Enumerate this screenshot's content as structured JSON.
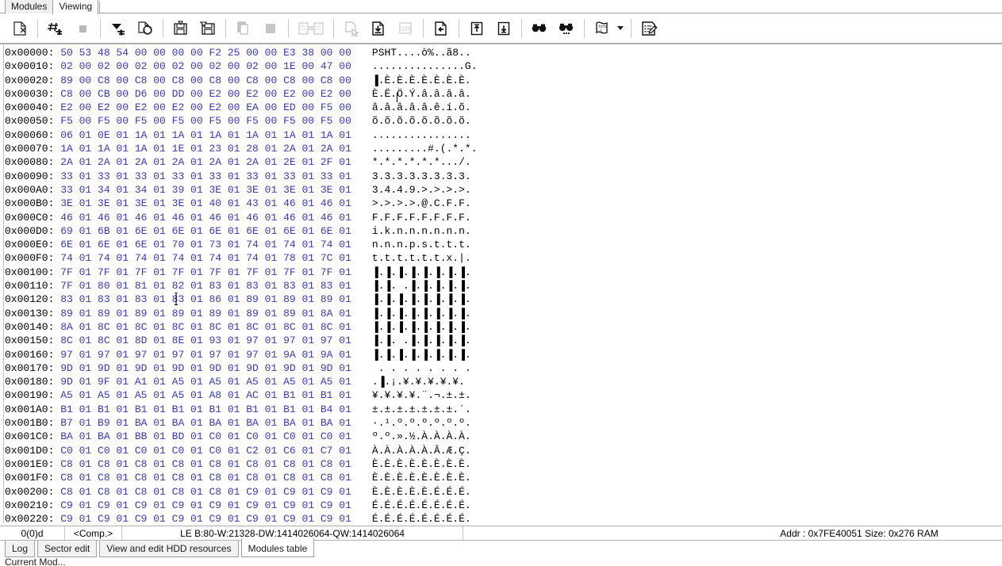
{
  "window": {
    "tabs": [
      {
        "label": "Modules",
        "active": false
      },
      {
        "label": "Viewing",
        "active": true
      }
    ]
  },
  "toolbar": {
    "buttons": [
      {
        "name": "new-file-icon",
        "title": "New"
      },
      {
        "name": "hash-goto-icon",
        "title": "Go to offset"
      },
      {
        "name": "stop-square-icon",
        "title": "Stop"
      },
      {
        "name": "filter-dropdown-icon",
        "title": "Filter"
      },
      {
        "name": "refresh-page-icon",
        "title": "Refresh"
      },
      {
        "name": "save-icon",
        "title": "Save"
      },
      {
        "name": "save-as-icon",
        "title": "Save as"
      },
      {
        "name": "copy-icon",
        "title": "Copy"
      },
      {
        "name": "paste-block-icon",
        "title": "Paste"
      },
      {
        "name": "compare-icon",
        "title": "Compare"
      },
      {
        "name": "select-page-icon",
        "title": "Select"
      },
      {
        "name": "write-page-icon",
        "title": "Write"
      },
      {
        "name": "numeric-123-icon",
        "title": "Numbers"
      },
      {
        "name": "export-page-icon",
        "title": "Export"
      },
      {
        "name": "page-up-icon",
        "title": "Previous block"
      },
      {
        "name": "page-down-icon",
        "title": "Next block"
      },
      {
        "name": "find-icon",
        "title": "Find"
      },
      {
        "name": "find-more-icon",
        "title": "Find next"
      },
      {
        "name": "script-info-icon",
        "title": "Info"
      },
      {
        "name": "toolbar-dropdown-arrow",
        "title": "More"
      },
      {
        "name": "edit-notes-icon",
        "title": "Edit"
      }
    ]
  },
  "hex": {
    "rows": [
      {
        "offset": "0x00000:",
        "bytes": "50 53 48 54 00 00 00 00 F2 25 00 00 E3 38 00 00",
        "ascii": "PSHT....ò%..ã8.."
      },
      {
        "offset": "0x00010:",
        "bytes": "02 00 02 00 02 00 02 00 02 00 02 00 1E 00 47 00",
        "ascii": "...............G."
      },
      {
        "offset": "0x00020:",
        "bytes": "89 00 C8 00 C8 00 C8 00 C8 00 C8 00 C8 00 C8 00",
        "ascii": "▐.È.È.È.È.È.È.È."
      },
      {
        "offset": "0x00030:",
        "bytes": "C8 00 CB 00 D6 00 DD 00 E2 00 E2 00 E2 00 E2 00",
        "ascii": "È.Ë.Ö.Ý.â.â.â.â."
      },
      {
        "offset": "0x00040:",
        "bytes": "E2 00 E2 00 E2 00 E2 00 E2 00 EA 00 ED 00 F5 00",
        "ascii": "â.â.â.â.â.ê.í.õ."
      },
      {
        "offset": "0x00050:",
        "bytes": "F5 00 F5 00 F5 00 F5 00 F5 00 F5 00 F5 00 F5 00",
        "ascii": "õ.õ.õ.õ.õ.õ.õ.õ."
      },
      {
        "offset": "0x00060:",
        "bytes": "06 01 0E 01 1A 01 1A 01 1A 01 1A 01 1A 01 1A 01",
        "ascii": "................"
      },
      {
        "offset": "0x00070:",
        "bytes": "1A 01 1A 01 1A 01 1E 01 23 01 28 01 2A 01 2A 01",
        "ascii": ".........#.(.*.*."
      },
      {
        "offset": "0x00080:",
        "bytes": "2A 01 2A 01 2A 01 2A 01 2A 01 2A 01 2E 01 2F 01",
        "ascii": "*.*.*.*.*.*.../."
      },
      {
        "offset": "0x00090:",
        "bytes": "33 01 33 01 33 01 33 01 33 01 33 01 33 01 33 01",
        "ascii": "3.3.3.3.3.3.3.3."
      },
      {
        "offset": "0x000A0:",
        "bytes": "33 01 34 01 34 01 39 01 3E 01 3E 01 3E 01 3E 01",
        "ascii": "3.4.4.9.>.>.>.>."
      },
      {
        "offset": "0x000B0:",
        "bytes": "3E 01 3E 01 3E 01 3E 01 40 01 43 01 46 01 46 01",
        "ascii": ">.>.>.>.@.C.F.F."
      },
      {
        "offset": "0x000C0:",
        "bytes": "46 01 46 01 46 01 46 01 46 01 46 01 46 01 46 01",
        "ascii": "F.F.F.F.F.F.F.F."
      },
      {
        "offset": "0x000D0:",
        "bytes": "69 01 6B 01 6E 01 6E 01 6E 01 6E 01 6E 01 6E 01",
        "ascii": "i.k.n.n.n.n.n.n."
      },
      {
        "offset": "0x000E0:",
        "bytes": "6E 01 6E 01 6E 01 70 01 73 01 74 01 74 01 74 01",
        "ascii": "n.n.n.p.s.t.t.t."
      },
      {
        "offset": "0x000F0:",
        "bytes": "74 01 74 01 74 01 74 01 74 01 74 01 78 01 7C 01",
        "ascii": "t.t.t.t.t.t.x.|."
      },
      {
        "offset": "0x00100:",
        "bytes": "7F 01 7F 01 7F 01 7F 01 7F 01 7F 01 7F 01 7F 01",
        "ascii": "▐.▐.▐.▐.▐.▐.▐.▐."
      },
      {
        "offset": "0x00110:",
        "bytes": "7F 01 80 01 81 01 82 01 83 01 83 01 83 01 83 01",
        "ascii": "▐.▐. .▐.▐.▐.▐.▐."
      },
      {
        "offset": "0x00120:",
        "bytes": "83 01 83 01 83 01 83 01 86 01 89 01 89 01 89 01",
        "ascii": "▐.▐.▐.▐.▐.▐.▐.▐."
      },
      {
        "offset": "0x00130:",
        "bytes": "89 01 89 01 89 01 89 01 89 01 89 01 89 01 8A 01",
        "ascii": "▐.▐.▐.▐.▐.▐.▐.▐."
      },
      {
        "offset": "0x00140:",
        "bytes": "8A 01 8C 01 8C 01 8C 01 8C 01 8C 01 8C 01 8C 01",
        "ascii": "▐.▐.▐.▐.▐.▐.▐.▐."
      },
      {
        "offset": "0x00150:",
        "bytes": "8C 01 8C 01 8D 01 8E 01 93 01 97 01 97 01 97 01",
        "ascii": "▐.▐. .▐.▐.▐.▐.▐."
      },
      {
        "offset": "0x00160:",
        "bytes": "97 01 97 01 97 01 97 01 97 01 97 01 9A 01 9A 01",
        "ascii": "▐.▐.▐.▐.▐.▐.▐.▐."
      },
      {
        "offset": "0x00170:",
        "bytes": "9D 01 9D 01 9D 01 9D 01 9D 01 9D 01 9D 01 9D 01",
        "ascii": " . . . . . . . . "
      },
      {
        "offset": "0x00180:",
        "bytes": "9D 01 9F 01 A1 01 A5 01 A5 01 A5 01 A5 01 A5 01",
        "ascii": ".▐.¡.¥.¥.¥.¥.¥."
      },
      {
        "offset": "0x00190:",
        "bytes": "A5 01 A5 01 A5 01 A5 01 A8 01 AC 01 B1 01 B1 01",
        "ascii": "¥.¥.¥.¥.¨.¬.±.±."
      },
      {
        "offset": "0x001A0:",
        "bytes": "B1 01 B1 01 B1 01 B1 01 B1 01 B1 01 B1 01 B4 01",
        "ascii": "±.±.±.±.±.±.±.´."
      },
      {
        "offset": "0x001B0:",
        "bytes": "B7 01 B9 01 BA 01 BA 01 BA 01 BA 01 BA 01 BA 01",
        "ascii": "·.¹.º.º.º.º.º.º."
      },
      {
        "offset": "0x001C0:",
        "bytes": "BA 01 BA 01 BB 01 BD 01 C0 01 C0 01 C0 01 C0 01",
        "ascii": "º.º.».½.À.À.À.À."
      },
      {
        "offset": "0x001D0:",
        "bytes": "C0 01 C0 01 C0 01 C0 01 C0 01 C2 01 C6 01 C7 01",
        "ascii": "À.À.À.À.À.Â.Æ.Ç."
      },
      {
        "offset": "0x001E0:",
        "bytes": "C8 01 C8 01 C8 01 C8 01 C8 01 C8 01 C8 01 C8 01",
        "ascii": "È.È.È.È.È.È.È.È."
      },
      {
        "offset": "0x001F0:",
        "bytes": "C8 01 C8 01 C8 01 C8 01 C8 01 C8 01 C8 01 C8 01",
        "ascii": "È.È.È.È.È.È.È.È."
      },
      {
        "offset": "0x00200:",
        "bytes": "C8 01 C8 01 C8 01 C8 01 C8 01 C9 01 C9 01 C9 01",
        "ascii": "È.È.È.È.È.É.É.É."
      },
      {
        "offset": "0x00210:",
        "bytes": "C9 01 C9 01 C9 01 C9 01 C9 01 C9 01 C9 01 C9 01",
        "ascii": "É.É.É.É.É.É.É.É."
      },
      {
        "offset": "0x00220:",
        "bytes": "C9 01 C9 01 C9 01 C9 01 C9 01 C9 01 C9 01 C9 01",
        "ascii": "É.É.É.É.É.É.É.É."
      }
    ]
  },
  "status": {
    "position": "0(0)d",
    "comparison": "<Comp.>",
    "values": "LE B:80-W:21328-DW:1414026064-QW:1414026064",
    "address_info": "Addr : 0x7FE40051 Size: 0x276 RAM"
  },
  "bottom_tabs": [
    {
      "label": "Log",
      "active": false
    },
    {
      "label": "Sector edit",
      "active": false
    },
    {
      "label": "View and edit HDD resources",
      "active": false
    },
    {
      "label": "Modules table",
      "active": true
    }
  ],
  "clipped_text": "Current Mod...",
  "colors": {
    "byte_blue": "#3a3ab4",
    "text_black": "#000000",
    "border_gray": "#9aa0a6",
    "panel_bg": "#ffffff"
  }
}
